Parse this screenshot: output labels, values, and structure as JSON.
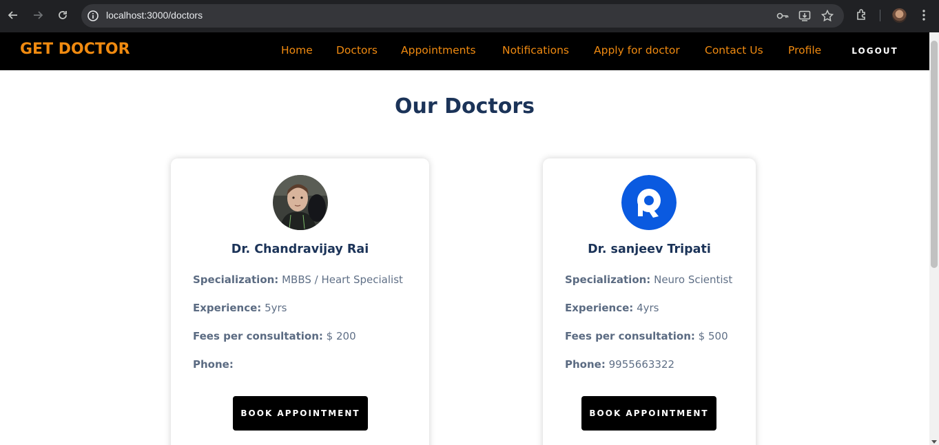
{
  "browser": {
    "url": "localhost:3000/doctors"
  },
  "navbar": {
    "brand": "GET DOCTOR",
    "links": [
      {
        "label": "Home"
      },
      {
        "label": "Doctors"
      },
      {
        "label": "Appointments"
      },
      {
        "label": "Notifications"
      },
      {
        "label": "Apply for doctor"
      },
      {
        "label": "Contact Us"
      },
      {
        "label": "Profile"
      }
    ],
    "logout_label": "LOGOUT"
  },
  "page": {
    "title": "Our Doctors"
  },
  "doctors": [
    {
      "name": "Dr. Chandravijay Rai",
      "specialization_label": "Specialization:",
      "specialization": "MBBS / Heart Specialist",
      "experience_label": "Experience:",
      "experience": "5yrs",
      "fees_label": "Fees per consultation:",
      "fees": "$ 200",
      "phone_label": "Phone:",
      "phone": "",
      "button_label": "BOOK APPOINTMENT",
      "avatar": "photo-avatar"
    },
    {
      "name": "Dr. sanjeev Tripati",
      "specialization_label": "Specialization:",
      "specialization": "Neuro Scientist",
      "experience_label": "Experience:",
      "experience": "4yrs",
      "fees_label": "Fees per consultation:",
      "fees": "$ 500",
      "phone_label": "Phone:",
      "phone": "9955663322",
      "button_label": "BOOK APPOINTMENT",
      "avatar": "q-logo-avatar"
    }
  ],
  "colors": {
    "brand_orange": "#f08a10",
    "navy": "#1b3358",
    "navbar_bg": "#000000",
    "button_bg": "#000000",
    "q_logo_blue": "#0a5ae0"
  }
}
